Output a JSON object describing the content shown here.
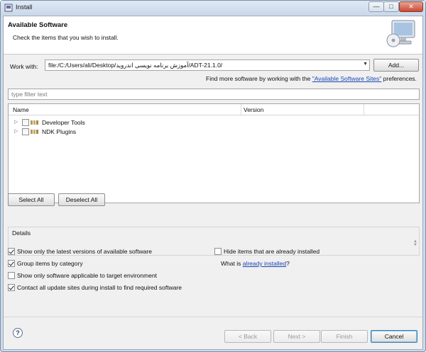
{
  "window": {
    "title": "Install",
    "min_glyph": "—",
    "max_glyph": "□",
    "close_glyph": "✕"
  },
  "header": {
    "title": "Available Software",
    "subtitle": "Check the items that you wish to install."
  },
  "work_with": {
    "label": "Work with:",
    "value": "file:/C:/Users/ali/Desktop/آموزش برنامه نویسی اندروید/ADT-21.1.0/",
    "add_button": "Add..."
  },
  "find_more": {
    "prefix": "Find more software by working with the ",
    "link": "\"Available Software Sites\"",
    "suffix": " preferences."
  },
  "filter": {
    "placeholder": "type filter text"
  },
  "tree": {
    "columns": [
      "Name",
      "Version"
    ],
    "rows": [
      {
        "label": "Developer Tools",
        "checked": false
      },
      {
        "label": "NDK Plugins",
        "checked": false
      }
    ]
  },
  "selection": {
    "select_all": "Select All",
    "deselect_all": "Deselect All"
  },
  "details": {
    "label": "Details"
  },
  "options": {
    "latest_versions": {
      "label": "Show only the latest versions of available software",
      "checked": true
    },
    "group_by_category": {
      "label": "Group items by category",
      "checked": true
    },
    "applicable_only": {
      "label": "Show only software applicable to target environment",
      "checked": false
    },
    "contact_sites": {
      "label": "Contact all update sites during install to find required software",
      "checked": true
    },
    "hide_installed": {
      "label": "Hide items that are already installed",
      "checked": false
    },
    "what_is_prefix": "What is ",
    "what_is_link": "already installed",
    "what_is_suffix": "?"
  },
  "footer": {
    "help_glyph": "?",
    "back": "< Back",
    "next": "Next >",
    "finish": "Finish",
    "cancel": "Cancel"
  }
}
